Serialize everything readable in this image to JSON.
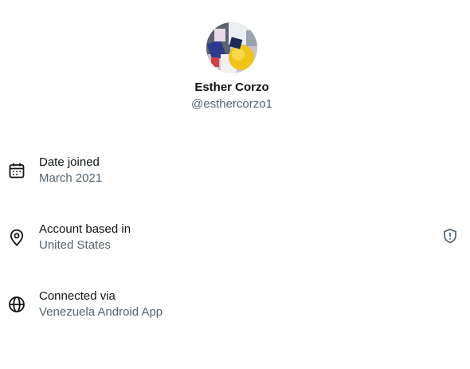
{
  "profile": {
    "display_name": "Esther Corzo",
    "handle": "@esthercorzo1"
  },
  "details": [
    {
      "icon": "calendar-icon",
      "label": "Date joined",
      "value": "March 2021"
    },
    {
      "icon": "location-pin-icon",
      "label": "Account based in",
      "value": "United States",
      "trailing_icon": "shield-alert-icon"
    },
    {
      "icon": "globe-icon",
      "label": "Connected via",
      "value": "Venezuela Android App"
    }
  ],
  "colors": {
    "primary_text": "#0f1419",
    "secondary_text": "#536471"
  }
}
